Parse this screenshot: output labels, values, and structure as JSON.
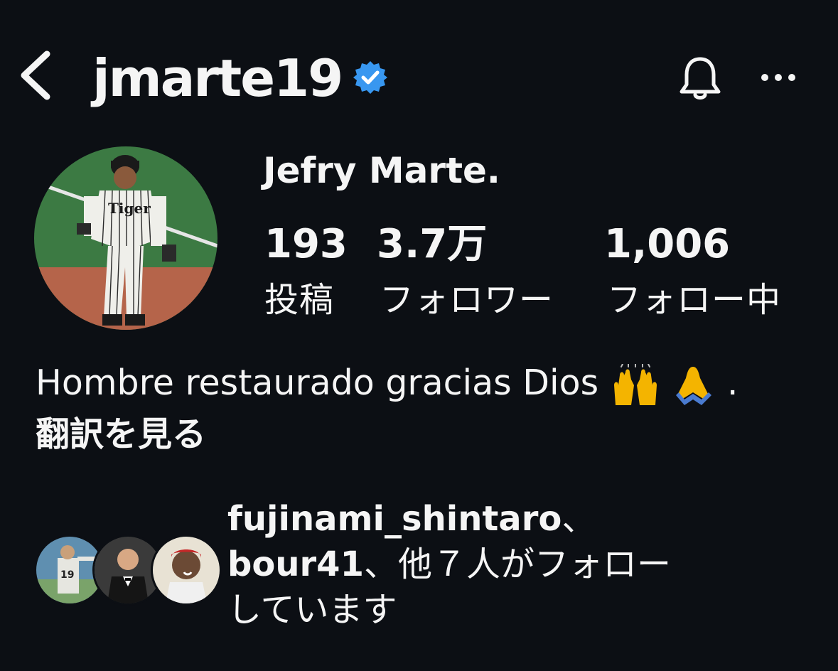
{
  "header": {
    "back_icon": "chevron-left-icon",
    "username": "jmarte19",
    "verified_icon": "verified-badge-icon",
    "notifications_icon": "bell-icon",
    "more_icon": "more-horizontal-icon",
    "verified_color": "#3897f0"
  },
  "profile": {
    "display_name": "Jefry Marte.",
    "stats": {
      "posts_value": "193",
      "posts_label": "投稿",
      "followers_value": "3.7万",
      "followers_label": "フォロワー",
      "following_value": "1,006",
      "following_label": "フォロー中"
    },
    "bio_text": "Hombre restaurado gracias Dios",
    "bio_end": ".",
    "translate_label": "翻訳を見る"
  },
  "followed_by": {
    "line1_user": "fujinami_shintaro",
    "line1_sep": "、",
    "line2_user": "bour41",
    "line2_rest": "、他７人がフォロー",
    "line3": "しています"
  },
  "colors": {
    "background": "#0c0f14",
    "text": "#f5f5f5"
  }
}
